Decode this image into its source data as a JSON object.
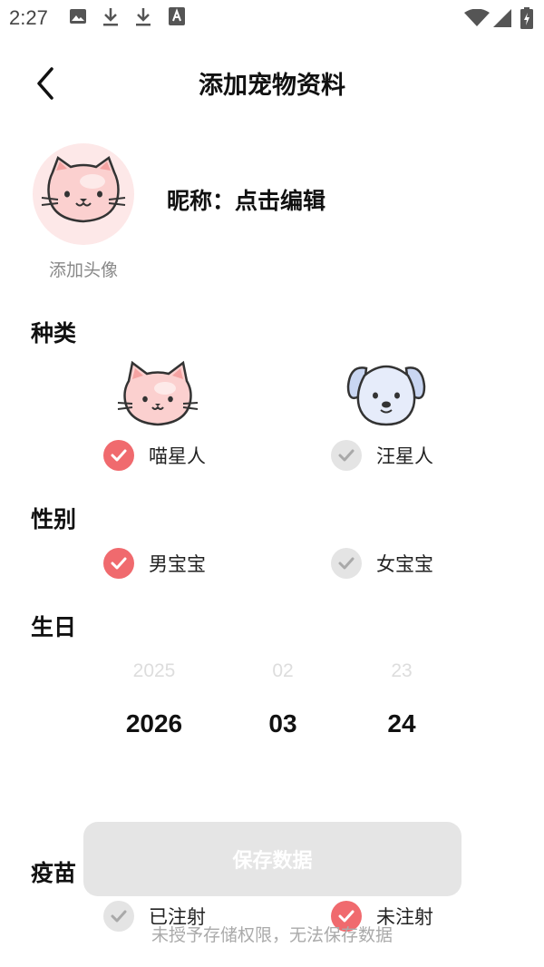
{
  "status_bar": {
    "time": "2:27",
    "icons_left": [
      "image-icon",
      "download-icon",
      "download-icon",
      "keyboard-a-icon"
    ],
    "icons_right": [
      "wifi-icon",
      "signal-icon",
      "battery-charging-icon"
    ]
  },
  "header": {
    "title": "添加宠物资料",
    "back_icon": "back-arrow-icon"
  },
  "profile": {
    "avatar_caption": "添加头像",
    "nickname": "昵称：点击编辑"
  },
  "species": {
    "label": "种类",
    "options": [
      {
        "label": "喵星人",
        "selected": true,
        "icon": "cat-icon"
      },
      {
        "label": "汪星人",
        "selected": false,
        "icon": "dog-icon"
      }
    ]
  },
  "gender": {
    "label": "性别",
    "options": [
      {
        "label": "男宝宝",
        "selected": true
      },
      {
        "label": "女宝宝",
        "selected": false
      }
    ]
  },
  "birthday": {
    "label": "生日",
    "year": {
      "prev": "2025",
      "current": "2026"
    },
    "month": {
      "prev": "02",
      "current": "03"
    },
    "day": {
      "prev": "23",
      "current": "24"
    }
  },
  "vaccine": {
    "label": "疫苗",
    "options": [
      {
        "label": "已注射",
        "selected": false
      },
      {
        "label": "未注射",
        "selected": true
      }
    ]
  },
  "save_button": {
    "label": "保存数据"
  },
  "toast": "未授予存储权限，无法保存数据",
  "colors": {
    "accent": "#f06a6e",
    "unchecked": "#e4e4e4",
    "avatar_bg": "#fde8e8",
    "button_disabled": "#e5e5e5"
  }
}
